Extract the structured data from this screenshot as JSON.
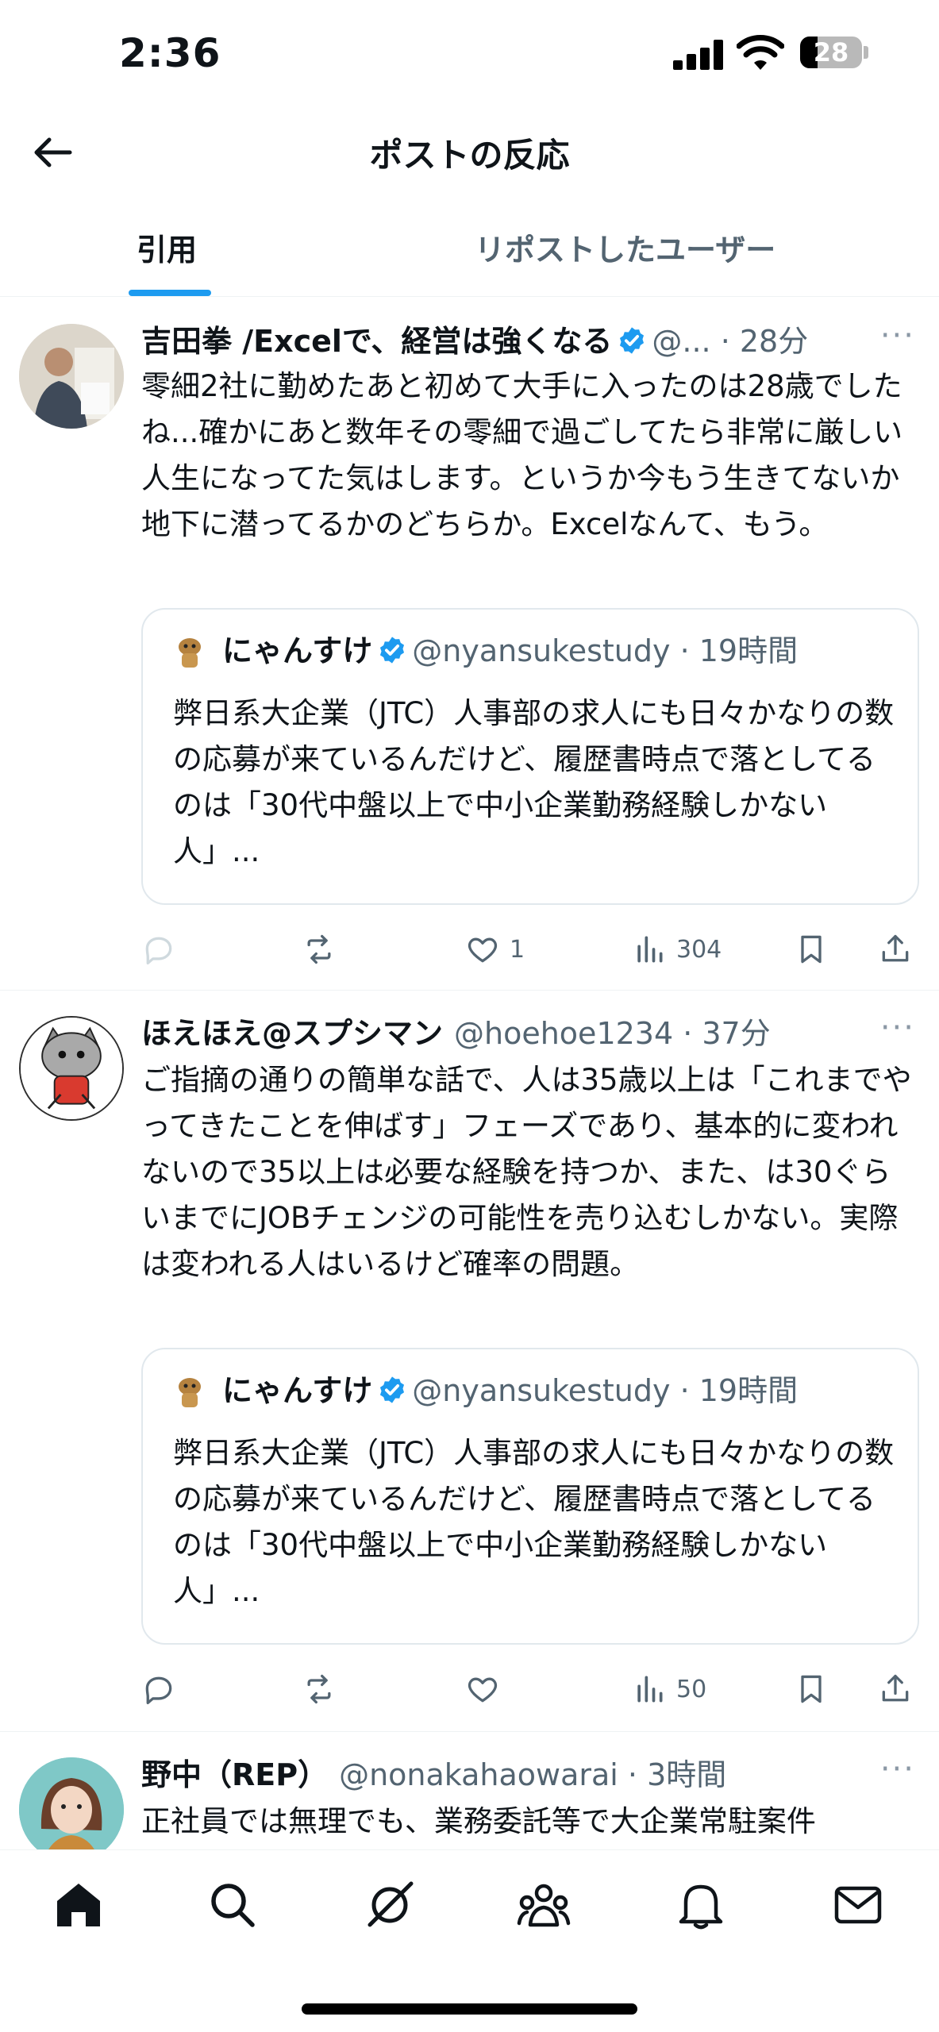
{
  "status_bar": {
    "time": "2:36",
    "battery": "28"
  },
  "header": {
    "title": "ポストの反応"
  },
  "tabs": [
    {
      "label": "引用",
      "active": true
    },
    {
      "label": "リポストしたユーザー",
      "active": false
    }
  ],
  "posts": [
    {
      "name": "吉田拳 /Excelで、経営は強くなる",
      "handle": "@... · 28分",
      "text": "零細2社に勤めたあと初めて大手に入ったのは28歳でしたね...確かにあと数年その零細で過ごしてたら非常に厳しい人生になってた気はします。というか今もう生きてないか地下に潜ってるかのどちらか。Excelなんて、もう。",
      "quote": {
        "name": "にゃんすけ",
        "handle": "@nyansukestudy · 19時間",
        "text": "弊日系大企業（JTC）人事部の求人にも日々かなりの数の応募が来ているんだけど、履歴書時点で落としてるのは「30代中盤以上で中小企業勤務経験しかない人」..."
      },
      "actions": {
        "replies": "",
        "reposts": "",
        "likes": "1",
        "views": "304"
      }
    },
    {
      "name": "ほえほえ@スプシマン",
      "handle": "@hoehoe1234 · 37分",
      "text": "ご指摘の通りの簡単な話で、人は35歳以上は「これまでやってきたことを伸ばす」フェーズであり、基本的に変われないので35以上は必要な経験を持つか、また、は30ぐらいまでにJOBチェンジの可能性を売り込むしかない。実際は変われる人はいるけど確率の問題。",
      "quote": {
        "name": "にゃんすけ",
        "handle": "@nyansukestudy · 19時間",
        "text": "弊日系大企業（JTC）人事部の求人にも日々かなりの数の応募が来ているんだけど、履歴書時点で落としてるのは「30代中盤以上で中小企業勤務経験しかない人」..."
      },
      "actions": {
        "replies": "",
        "reposts": "",
        "likes": "",
        "views": "50"
      }
    },
    {
      "name": "野中（REP）",
      "handle": "@nonakahaowarai · 3時間",
      "text": "正社員では無理でも、業務委託等で大企業常駐案件"
    }
  ],
  "bottom_nav": [
    "home-icon",
    "search-icon",
    "grok-icon",
    "communities-icon",
    "notifications-icon",
    "messages-icon"
  ],
  "colors": {
    "accent": "#1d9bf0",
    "text": "#0f1419",
    "secondary": "#536471",
    "border": "#eff3f4"
  }
}
